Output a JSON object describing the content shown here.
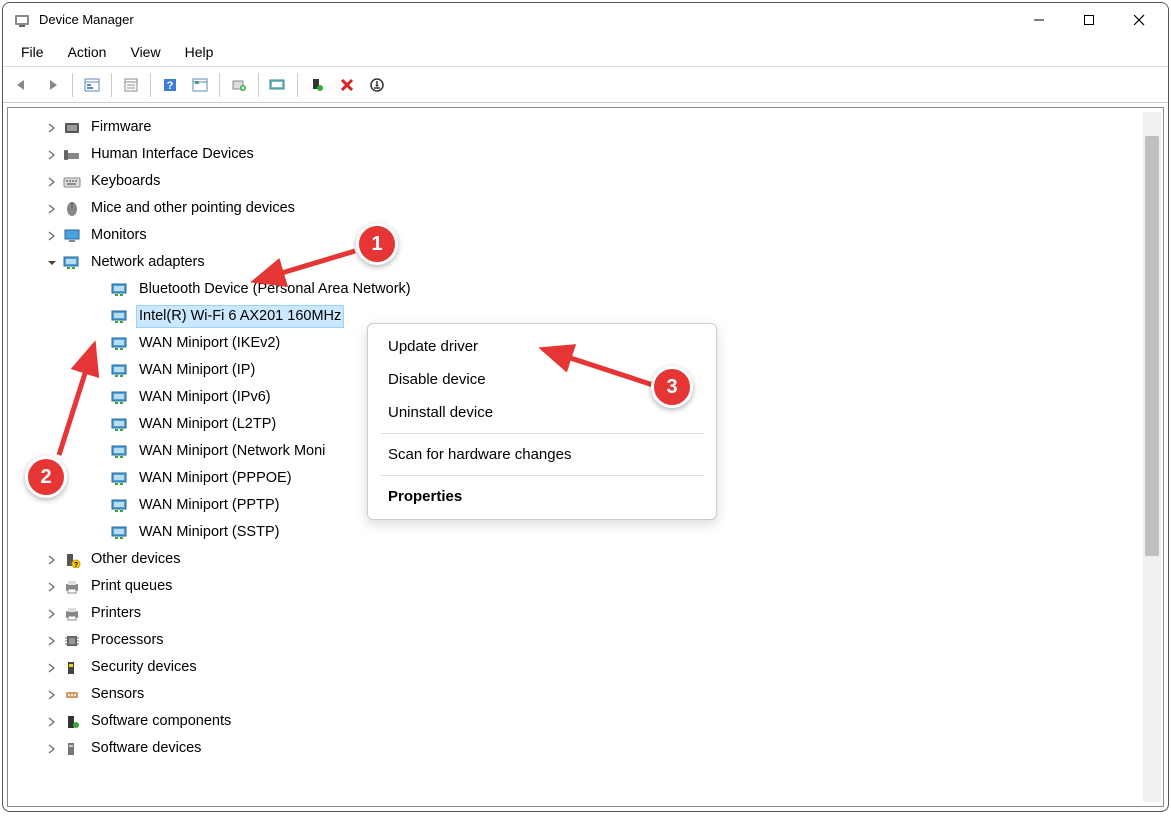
{
  "window": {
    "title": "Device Manager"
  },
  "menus": [
    "File",
    "Action",
    "View",
    "Help"
  ],
  "tree": {
    "items": [
      {
        "label": "Firmware",
        "icon": "firmware",
        "expander": ">",
        "indent": 1
      },
      {
        "label": "Human Interface Devices",
        "icon": "hid",
        "expander": ">",
        "indent": 1
      },
      {
        "label": "Keyboards",
        "icon": "keyboard",
        "expander": ">",
        "indent": 1
      },
      {
        "label": "Mice and other pointing devices",
        "icon": "mouse",
        "expander": ">",
        "indent": 1
      },
      {
        "label": "Monitors",
        "icon": "monitor",
        "expander": ">",
        "indent": 1
      },
      {
        "label": "Network adapters",
        "icon": "network",
        "expander": "v",
        "indent": 1
      },
      {
        "label": "Bluetooth Device (Personal Area Network)",
        "icon": "network",
        "expander": "",
        "indent": 2
      },
      {
        "label": "Intel(R) Wi-Fi 6 AX201 160MHz",
        "icon": "network",
        "expander": "",
        "indent": 2,
        "selected": true
      },
      {
        "label": "WAN Miniport (IKEv2)",
        "icon": "network",
        "expander": "",
        "indent": 2
      },
      {
        "label": "WAN Miniport (IP)",
        "icon": "network",
        "expander": "",
        "indent": 2
      },
      {
        "label": "WAN Miniport (IPv6)",
        "icon": "network",
        "expander": "",
        "indent": 2
      },
      {
        "label": "WAN Miniport (L2TP)",
        "icon": "network",
        "expander": "",
        "indent": 2
      },
      {
        "label": "WAN Miniport (Network Moni",
        "icon": "network",
        "expander": "",
        "indent": 2
      },
      {
        "label": "WAN Miniport (PPPOE)",
        "icon": "network",
        "expander": "",
        "indent": 2
      },
      {
        "label": "WAN Miniport (PPTP)",
        "icon": "network",
        "expander": "",
        "indent": 2
      },
      {
        "label": "WAN Miniport (SSTP)",
        "icon": "network",
        "expander": "",
        "indent": 2
      },
      {
        "label": "Other devices",
        "icon": "other",
        "expander": ">",
        "indent": 1
      },
      {
        "label": "Print queues",
        "icon": "printer",
        "expander": ">",
        "indent": 1
      },
      {
        "label": "Printers",
        "icon": "printer",
        "expander": ">",
        "indent": 1
      },
      {
        "label": "Processors",
        "icon": "processor",
        "expander": ">",
        "indent": 1
      },
      {
        "label": "Security devices",
        "icon": "security",
        "expander": ">",
        "indent": 1
      },
      {
        "label": "Sensors",
        "icon": "sensor",
        "expander": ">",
        "indent": 1
      },
      {
        "label": "Software components",
        "icon": "software",
        "expander": ">",
        "indent": 1
      },
      {
        "label": "Software devices",
        "icon": "software-dev",
        "expander": ">",
        "indent": 1
      }
    ]
  },
  "contextMenu": {
    "items": [
      {
        "label": "Update driver",
        "type": "item"
      },
      {
        "label": "Disable device",
        "type": "item"
      },
      {
        "label": "Uninstall device",
        "type": "item"
      },
      {
        "type": "sep"
      },
      {
        "label": "Scan for hardware changes",
        "type": "item"
      },
      {
        "type": "sep"
      },
      {
        "label": "Properties",
        "type": "item",
        "bold": true
      }
    ]
  },
  "annotations": {
    "b1": "1",
    "b2": "2",
    "b3": "3"
  }
}
